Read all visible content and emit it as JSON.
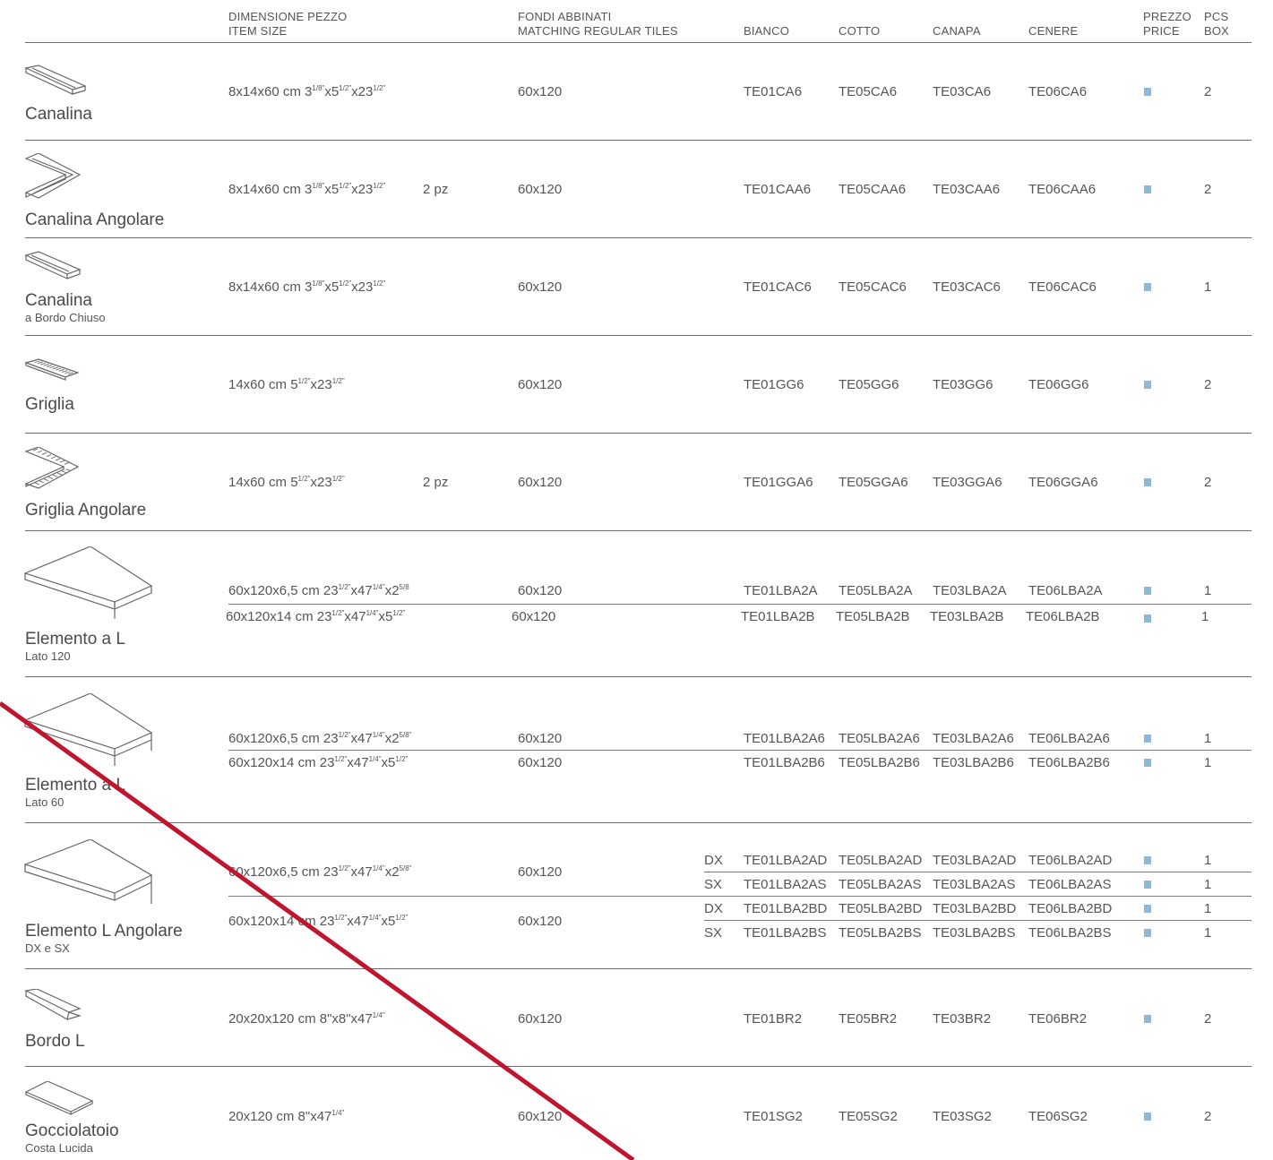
{
  "header": {
    "size_it": "DIMENSIONE PEZZO",
    "size_en": "ITEM SIZE",
    "match_it": "FONDI ABBINATI",
    "match_en": "MATCHING REGULAR TILES",
    "bianco": "BIANCO",
    "cotto": "COTTO",
    "canapa": "CANAPA",
    "cenere": "CENERE",
    "price_it": "PREZZO",
    "price_en": "PRICE",
    "box_it": "PCS",
    "box_en": "BOX"
  },
  "colors": {
    "price_marker": "#8fb8d6",
    "watermark": "#c0152f"
  },
  "products": [
    {
      "name": "Canalina",
      "icon": "channel-icon",
      "rows": [
        {
          "size": "8x14x60 cm 3<sup>1/8\"</sup>x5<sup>1/2\"</sup>x23<sup>1/2\"</sup>",
          "match": "60x120",
          "codes": [
            "TE01CA6",
            "TE05CA6",
            "TE03CA6",
            "TE06CA6"
          ],
          "box": "2"
        }
      ]
    },
    {
      "name": "Canalina Angolare",
      "icon": "corner-channel-icon",
      "rows": [
        {
          "size": "8x14x60 cm 3<sup>1/8\"</sup>x5<sup>1/2\"</sup>x23<sup>1/2\"</sup>",
          "qty": "2 pz",
          "match": "60x120",
          "codes": [
            "TE01CAA6",
            "TE05CAA6",
            "TE03CAA6",
            "TE06CAA6"
          ],
          "box": "2"
        }
      ]
    },
    {
      "name": "Canalina",
      "sub": "a Bordo Chiuso",
      "icon": "closed-channel-icon",
      "rows": [
        {
          "size": "8x14x60 cm 3<sup>1/8\"</sup>x5<sup>1/2\"</sup>x23<sup>1/2\"</sup>",
          "match": "60x120",
          "codes": [
            "TE01CAC6",
            "TE05CAC6",
            "TE03CAC6",
            "TE06CAC6"
          ],
          "box": "1"
        }
      ]
    },
    {
      "name": "Griglia",
      "icon": "grate-icon",
      "rows": [
        {
          "size": "14x60 cm 5<sup>1/2\"</sup>x23<sup>1/2\"</sup>",
          "match": "60x120",
          "codes": [
            "TE01GG6",
            "TE05GG6",
            "TE03GG6",
            "TE06GG6"
          ],
          "box": "2"
        }
      ]
    },
    {
      "name": "Griglia Angolare",
      "icon": "corner-grate-icon",
      "rows": [
        {
          "size": "14x60 cm 5<sup>1/2\"</sup>x23<sup>1/2\"</sup>",
          "qty": "2 pz",
          "match": "60x120",
          "codes": [
            "TE01GGA6",
            "TE05GGA6",
            "TE03GGA6",
            "TE06GGA6"
          ],
          "box": "2"
        }
      ]
    },
    {
      "name": "Elemento a L",
      "sub": "Lato 120",
      "icon": "l-step-120-icon",
      "rows": [
        {
          "size": "60x120x6,5 cm 23<sup>1/2\"</sup>x47<sup>1/4\"</sup>x2<sup>5/8</sup>",
          "match": "60x120",
          "codes": [
            "TE01LBA2A",
            "TE05LBA2A",
            "TE03LBA2A",
            "TE06LBA2A"
          ],
          "box": "1"
        },
        {
          "size": "60x120x14 cm 23<sup>1/2\"</sup>x47<sup>1/4\"</sup>x5<sup>1/2\"</sup>",
          "match": "60x120",
          "codes": [
            "TE01LBA2B",
            "TE05LBA2B",
            "TE03LBA2B",
            "TE06LBA2B"
          ],
          "box": "1"
        }
      ]
    },
    {
      "name": "Elemento a L",
      "sub": "Lato 60",
      "icon": "l-step-60-icon",
      "rows": [
        {
          "size": "60x120x6,5 cm 23<sup>1/2\"</sup>x47<sup>1/4\"</sup>x2<sup>5/8\"</sup>",
          "match": "60x120",
          "codes": [
            "TE01LBA2A6",
            "TE05LBA2A6",
            "TE03LBA2A6",
            "TE06LBA2A6"
          ],
          "box": "1"
        },
        {
          "size": "60x120x14 cm 23<sup>1/2\"</sup>x47<sup>1/4\"</sup>x5<sup>1/2\"</sup>",
          "match": "60x120",
          "codes": [
            "TE01LBA2B6",
            "TE05LBA2B6",
            "TE03LBA2B6",
            "TE06LBA2B6"
          ],
          "box": "1"
        }
      ]
    },
    {
      "name": "Elemento L Angolare",
      "sub": "DX e SX",
      "icon": "l-corner-step-icon",
      "groups": [
        {
          "size": "60x120x6,5 cm 23<sup>1/2\"</sup>x47<sup>1/4\"</sup>x2<sup>5/8\"</sup>",
          "match": "60x120",
          "rows": [
            {
              "side": "DX",
              "codes": [
                "TE01LBA2AD",
                "TE05LBA2AD",
                "TE03LBA2AD",
                "TE06LBA2AD"
              ],
              "box": "1"
            },
            {
              "side": "SX",
              "codes": [
                "TE01LBA2AS",
                "TE05LBA2AS",
                "TE03LBA2AS",
                "TE06LBA2AS"
              ],
              "box": "1"
            }
          ]
        },
        {
          "size": "60x120x14 cm 23<sup>1/2\"</sup>x47<sup>1/4\"</sup>x5<sup>1/2\"</sup>",
          "match": "60x120",
          "rows": [
            {
              "side": "DX",
              "codes": [
                "TE01LBA2BD",
                "TE05LBA2BD",
                "TE03LBA2BD",
                "TE06LBA2BD"
              ],
              "box": "1"
            },
            {
              "side": "SX",
              "codes": [
                "TE01LBA2BS",
                "TE05LBA2BS",
                "TE03LBA2BS",
                "TE06LBA2BS"
              ],
              "box": "1"
            }
          ]
        }
      ]
    },
    {
      "name": "Bordo L",
      "icon": "l-edge-icon",
      "rows": [
        {
          "size": "20x20x120 cm 8\"x8\"x47<sup>1/4\"</sup>",
          "match": "60x120",
          "codes": [
            "TE01BR2",
            "TE05BR2",
            "TE03BR2",
            "TE06BR2"
          ],
          "box": "2"
        }
      ]
    },
    {
      "name": "Gocciolatoio",
      "sub": "Costa Lucida",
      "icon": "drip-edge-icon",
      "rows": [
        {
          "size": "20x120 cm 8\"x47<sup>1/4\"</sup>",
          "match": "60x120",
          "codes": [
            "TE01SG2",
            "TE05SG2",
            "TE03SG2",
            "TE06SG2"
          ],
          "box": "2"
        }
      ]
    }
  ]
}
